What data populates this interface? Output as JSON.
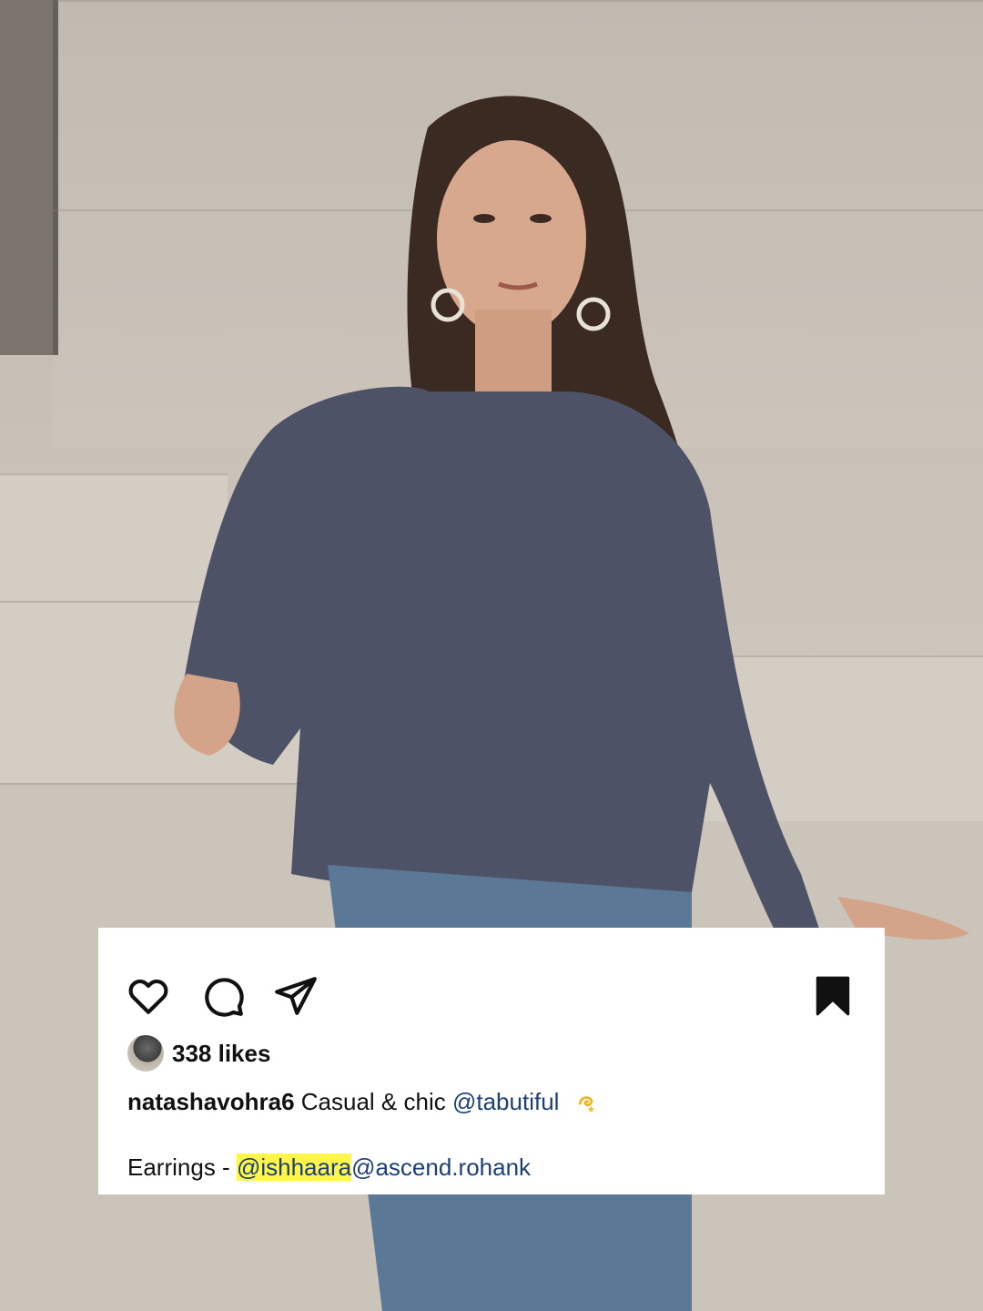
{
  "post": {
    "actions": {
      "like_icon": "heart-outline",
      "comment_icon": "speech-bubble",
      "share_icon": "paper-plane",
      "save_icon": "bookmark-filled"
    },
    "likes_text": "338 likes",
    "username": "natashavohra6",
    "caption_text": "Casual & chic",
    "caption_mention": "@tabutiful",
    "earrings_label": "Earrings -",
    "mention_1": "@ishhaara",
    "mention_2": "@ascend.rohank"
  },
  "colors": {
    "card_bg": "#ffffff",
    "mention": "#1c3f77",
    "highlight": "#fff64a",
    "text": "#111111"
  }
}
